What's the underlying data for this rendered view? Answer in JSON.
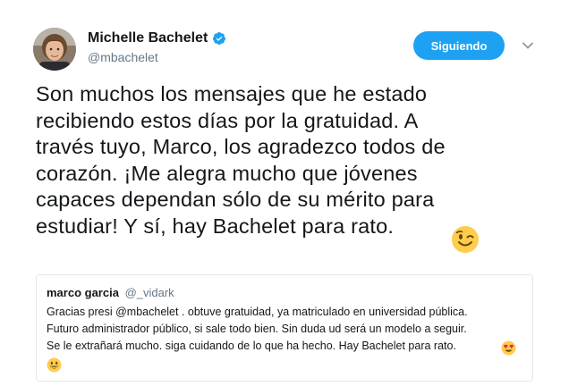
{
  "author": {
    "display_name": "Michelle Bachelet",
    "handle": "@mbachelet",
    "verified_icon": "verified-badge-icon"
  },
  "follow_button": {
    "label": "Siguiendo"
  },
  "menu": {
    "icon": "chevron-down-icon"
  },
  "tweet": {
    "text": "Son muchos los mensajes que he estado\nrecibiendo estos días por la gratuidad. A\ntravés tuyo, Marco, los agradezco todos de\ncorazón. ¡Me alegra mucho que jóvenes\ncapaces dependan sólo de su mérito para\nestudiar!  Y sí, hay Bachelet para rato.",
    "emoji": "winking-face-emoji"
  },
  "quoted_tweet": {
    "name": "marco garcia",
    "handle": "@_vidark",
    "text": "Gracias presi @mbachelet . obtuve gratuidad, ya matriculado en universidad pública.\nFuturo administrador público, si sale todo bien. Sin duda ud será un modelo a seguir.\nSe le extrañará mucho. siga cuidando de lo que ha hecho. Hay Bachelet para rato.",
    "emojis": [
      "heart-eyes-emoji",
      "grinning-face-emoji"
    ]
  },
  "colors": {
    "accent": "#1da1f2",
    "text": "#14171a",
    "secondary_text": "#657786",
    "border": "#e1e8ed",
    "emoji_yellow": "#ffcc4d"
  }
}
